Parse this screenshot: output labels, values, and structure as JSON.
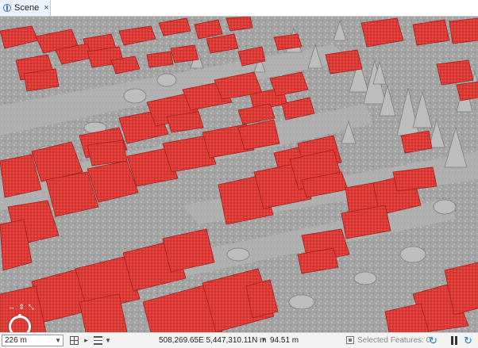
{
  "tab": {
    "title": "Scene",
    "close": "×",
    "icon": "globe-icon"
  },
  "nav": {
    "arrows_label": "↔ ⇕ ⤡",
    "icon": "navigator-ring-icon"
  },
  "colors": {
    "building": "#dd3a35",
    "building_edge": "#a51e1b",
    "ground": "#9a9a9a",
    "tree": "#b6b6b6"
  },
  "status": {
    "scale": "226 m",
    "coordinates": "508,269.65E 5,447,310.11N m",
    "elevation": "94.51 m",
    "selected_features": "Selected Features: 0"
  }
}
